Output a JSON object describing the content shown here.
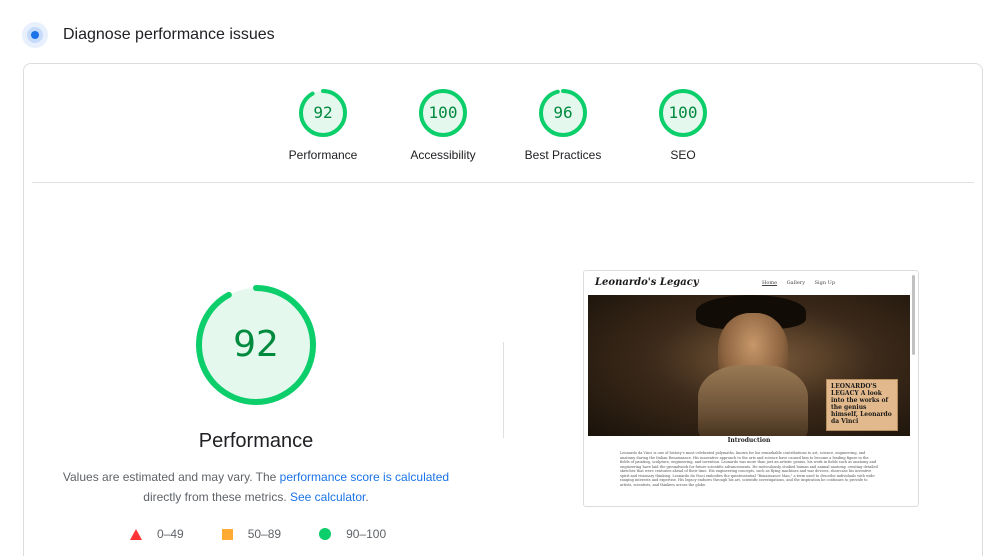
{
  "header": {
    "title": "Diagnose performance issues",
    "icon": "performance-target-icon"
  },
  "gauges": [
    {
      "score": "92",
      "value": 92,
      "label": "Performance"
    },
    {
      "score": "100",
      "value": 100,
      "label": "Accessibility"
    },
    {
      "score": "96",
      "value": 96,
      "label": "Best Practices"
    },
    {
      "score": "100",
      "value": 100,
      "label": "SEO"
    }
  ],
  "main": {
    "score": "92",
    "value": 92,
    "title": "Performance",
    "desc_prefix": "Values are estimated and may vary. The ",
    "desc_link1": "performance score is calculated",
    "desc_middle": " directly from these metrics. ",
    "desc_link2": "See calculator",
    "desc_suffix": "."
  },
  "legend": [
    {
      "range": "0–49",
      "icon": "triangle-fail-icon",
      "color": "#ff3333"
    },
    {
      "range": "50–89",
      "icon": "square-average-icon",
      "color": "#ffaa33"
    },
    {
      "range": "90–100",
      "icon": "circle-pass-icon",
      "color": "#0cce6b"
    }
  ],
  "screenshot": {
    "logo": "Leonardo's Legacy",
    "nav": [
      "Home",
      "Gallery",
      "Sign Up"
    ],
    "hero_box": "LEONARDO'S LEGACY A look into the works of the genius himself, Leonardo da Vinci",
    "intro_title": "Introduction",
    "intro_text": "Leonardo da Vinci is one of history's most celebrated polymaths, known for his remarkable contributions to art, science, engineering, and anatomy during the Italian Renaissance. His innovative approach to the arts and science have caused him to become a leading figure in the fields of painting, sculpture, engineering, and invention. Leonardo was more than just an artistic genius, his work in fields such as anatomy and engineering have laid the groundwork for future scientific advancements. He meticulously studied human and animal anatomy, creating detailed sketches that were centuries ahead of their time. His engineering concepts, such as flying machines and war devices, showcase his inventive spirit and visionary thinking. Leonardo da Vinci embodies the quintessential \"Renaissance Man,\" a term used to describe individuals with wide-ranging interests and expertise. His legacy endures through his art, scientific investigations, and the inspiration he continues to provide to artists, scientists, and thinkers across the globe."
  },
  "colors": {
    "pass": "#0cce6b",
    "pass_text": "#008a3e",
    "pass_fill": "#e5f8ee",
    "link": "#1a73e8"
  }
}
